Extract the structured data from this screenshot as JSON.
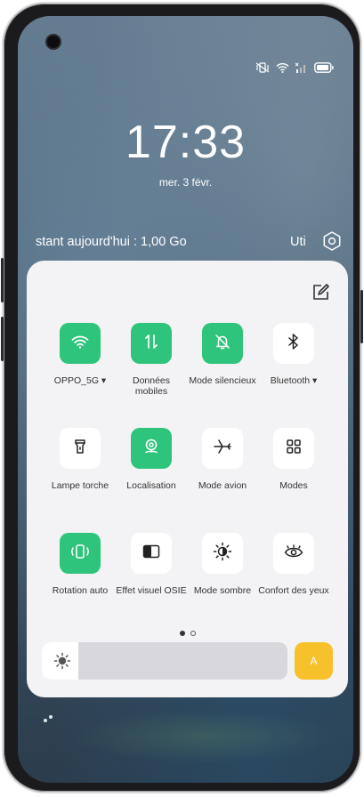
{
  "status_bar": {
    "icons": [
      "vibrate-icon",
      "wifi-icon",
      "signal-icon",
      "battery-icon"
    ]
  },
  "lockscreen": {
    "time": "17:33",
    "date": "mer. 3 févr.",
    "data_usage": "stant aujourd'hui : 1,00 Go",
    "data_usage_right": "Uti"
  },
  "quick_settings": {
    "tiles": [
      {
        "id": "wifi",
        "label": "OPPO_5G ▾",
        "active": true,
        "icon": "wifi-icon"
      },
      {
        "id": "mobile-data",
        "label": "Données mobiles",
        "active": true,
        "icon": "mobile-data-icon"
      },
      {
        "id": "silent",
        "label": "Mode silencieux",
        "active": true,
        "icon": "bell-off-icon"
      },
      {
        "id": "bluetooth",
        "label": "Bluetooth ▾",
        "active": false,
        "icon": "bluetooth-icon"
      },
      {
        "id": "flashlight",
        "label": "Lampe torche",
        "active": false,
        "icon": "flashlight-icon"
      },
      {
        "id": "location",
        "label": "Localisation",
        "active": true,
        "icon": "location-icon"
      },
      {
        "id": "airplane",
        "label": "Mode avion",
        "active": false,
        "icon": "airplane-icon"
      },
      {
        "id": "modes",
        "label": "Modes",
        "active": false,
        "icon": "grid-icon"
      },
      {
        "id": "rotation",
        "label": "Rotation auto",
        "active": true,
        "icon": "rotate-icon"
      },
      {
        "id": "osie",
        "label": "Effet visuel OSIE",
        "active": false,
        "icon": "contrast-icon"
      },
      {
        "id": "dark",
        "label": "Mode sombre",
        "active": false,
        "icon": "brightness-half-icon"
      },
      {
        "id": "eye",
        "label": "Confort des yeux",
        "active": false,
        "icon": "eye-icon"
      }
    ],
    "brightness_level": 0.15,
    "auto_label": "A",
    "page_indicator": {
      "current": 1,
      "total": 2
    }
  },
  "colors": {
    "accent_green": "#2fc47c",
    "auto_yellow": "#f6c12a"
  }
}
